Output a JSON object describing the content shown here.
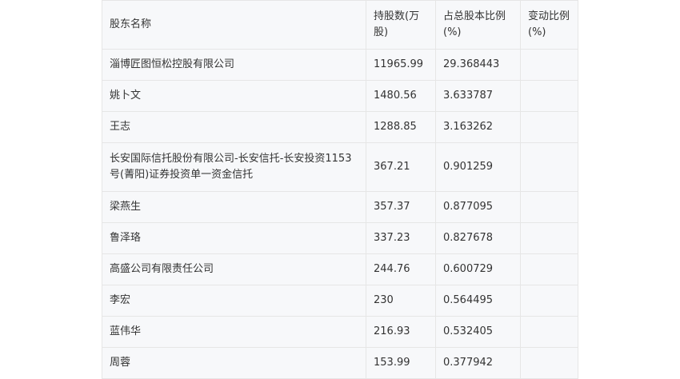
{
  "table": {
    "headers": [
      "股东名称",
      "持股数(万股)",
      "占总股本比例(%)",
      "变动比例(%)"
    ],
    "rows": [
      {
        "name": "淄博匠图恒松控股有限公司",
        "shares": "11965.99",
        "ratio": "29.368443",
        "change": ""
      },
      {
        "name": "姚卜文",
        "shares": "1480.56",
        "ratio": "3.633787",
        "change": ""
      },
      {
        "name": "王志",
        "shares": "1288.85",
        "ratio": "3.163262",
        "change": ""
      },
      {
        "name": "长安国际信托股份有限公司-长安信托-长安投资1153号(菁阳)证券投资单一资金信托",
        "shares": "367.21",
        "ratio": "0.901259",
        "change": ""
      },
      {
        "name": "梁燕生",
        "shares": "357.37",
        "ratio": "0.877095",
        "change": ""
      },
      {
        "name": "鲁泽珞",
        "shares": "337.23",
        "ratio": "0.827678",
        "change": ""
      },
      {
        "name": "高盛公司有限责任公司",
        "shares": "244.76",
        "ratio": "0.600729",
        "change": ""
      },
      {
        "name": "李宏",
        "shares": "230",
        "ratio": "0.564495",
        "change": ""
      },
      {
        "name": "蓝伟华",
        "shares": "216.93",
        "ratio": "0.532405",
        "change": ""
      },
      {
        "name": "周蓉",
        "shares": "153.99",
        "ratio": "0.377942",
        "change": ""
      }
    ]
  }
}
